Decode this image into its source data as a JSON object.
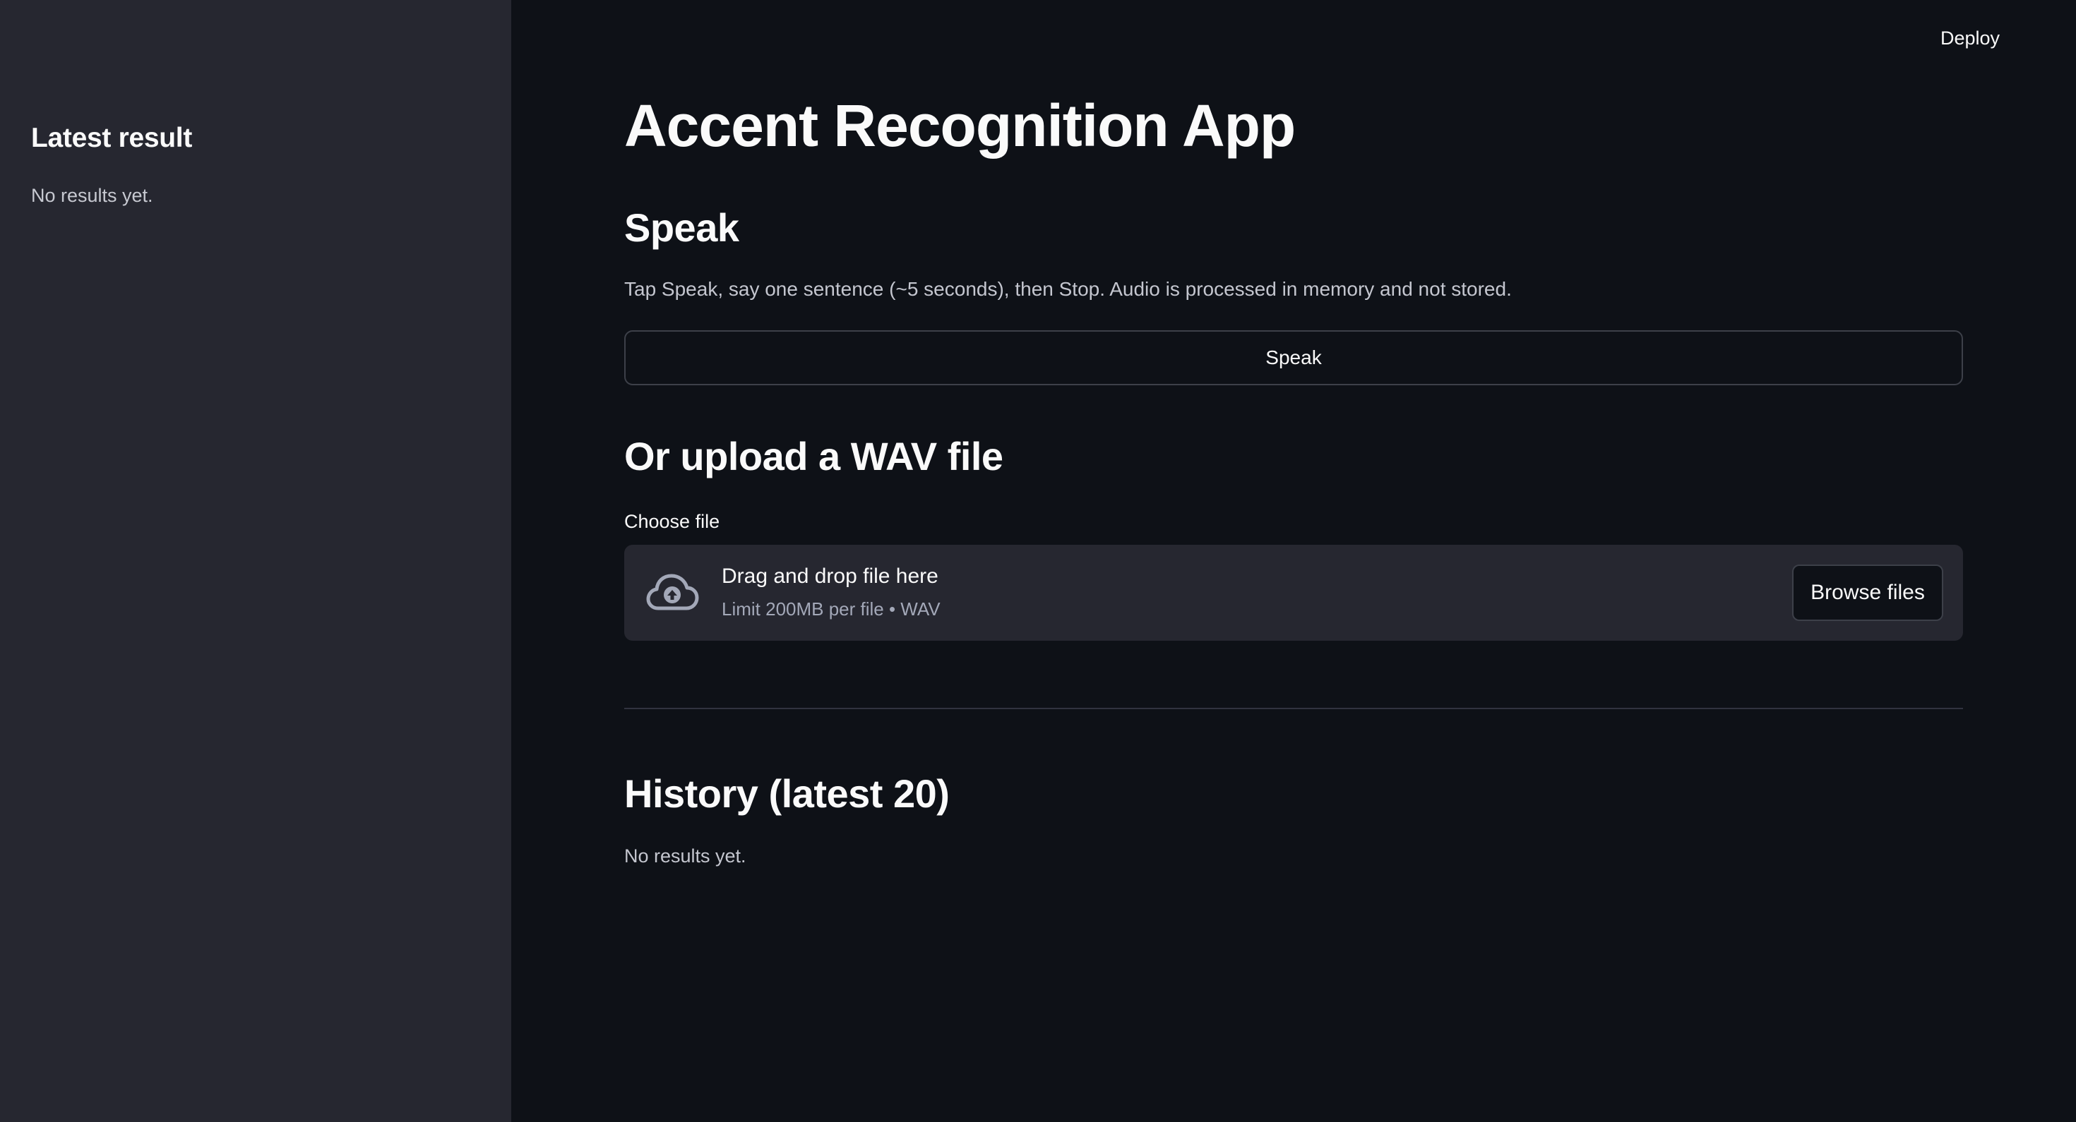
{
  "colors": {
    "background": "#0e1117",
    "sidebar_background": "#262730",
    "text": "#fafafa",
    "muted_text": "#c4c6cf",
    "border": "#3d4049"
  },
  "header": {
    "deploy_label": "Deploy"
  },
  "sidebar": {
    "title": "Latest result",
    "empty_text": "No results yet."
  },
  "main": {
    "title": "Accent Recognition App",
    "speak_section": {
      "heading": "Speak",
      "caption": "Tap Speak, say one sentence (~5 seconds), then Stop. Audio is processed in memory and not stored.",
      "button_label": "Speak"
    },
    "upload_section": {
      "heading": "Or upload a WAV file",
      "field_label": "Choose file",
      "dropzone_title": "Drag and drop file here",
      "dropzone_subtitle": "Limit 200MB per file • WAV",
      "dropzone_icon": "cloud-upload-icon",
      "browse_label": "Browse files"
    },
    "history_section": {
      "heading": "History (latest 20)",
      "empty_text": "No results yet."
    }
  }
}
